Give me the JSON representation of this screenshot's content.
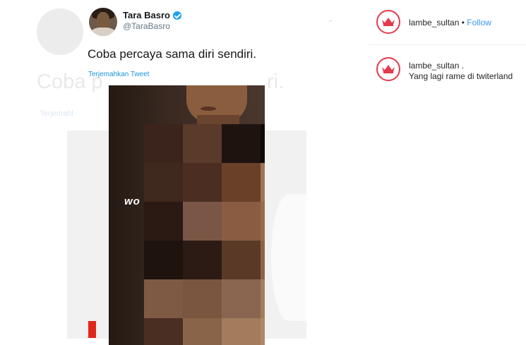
{
  "tweet": {
    "name": "Tara Basro",
    "handle": "@TaraBasro",
    "text": "Coba percaya sama diri sendiri.",
    "translate_label": "Terjemahkan Tweet"
  },
  "background_tweet": {
    "text_left": "Coba p",
    "text_right": "ri.",
    "translate_label": "Terjemahl"
  },
  "photo": {
    "overlay_text": "wo"
  },
  "instagram": {
    "header": {
      "username": "lambe_sultan",
      "separator": "•",
      "follow_label": "Follow"
    },
    "comment": {
      "username": "lambe_sultan .",
      "caption": "Yang lagi rame di twiterland"
    }
  },
  "colors": {
    "twitter_blue": "#1da1f2",
    "link_blue": "#1b95e0",
    "follow_blue": "#3897f0",
    "brand_red": "#e23b4b",
    "marker_red": "#e0261b"
  },
  "icons": {
    "verified": "verified-badge-icon",
    "avatar_logo": "crown-logo-icon"
  }
}
